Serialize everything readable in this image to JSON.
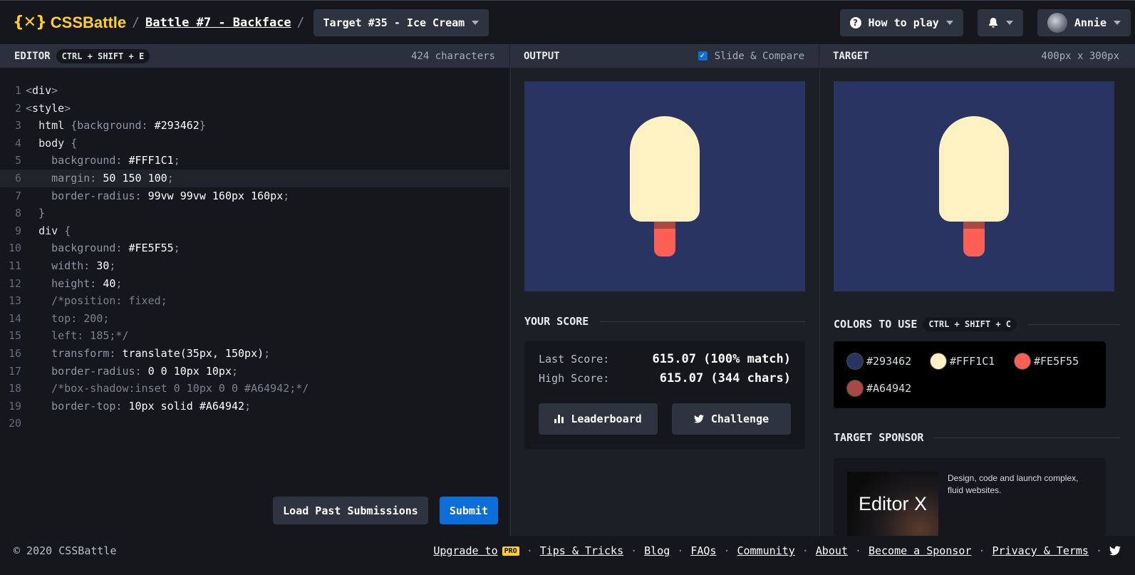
{
  "header": {
    "logo_mark": "{✕}",
    "logo_text": "CSSBattle",
    "battle": "Battle #7 - Backface",
    "target_select": "Target #35 - Ice Cream",
    "how_to_play": "How to play",
    "user": "Annie"
  },
  "editor": {
    "title": "EDITOR",
    "shortcut": "CTRL + SHIFT + E",
    "char_count": "424 characters",
    "load_past": "Load Past Submissions",
    "submit": "Submit",
    "lines": [
      "<div>",
      "<style>",
      "  html {background: #293462}",
      "  body {",
      "    background: #FFF1C1;",
      "    margin: 50 150 100;",
      "    border-radius: 99vw 99vw 160px 160px;",
      "  }",
      "  div {",
      "    background: #FE5F55;",
      "    width: 30;",
      "    height: 40;",
      "    /*position: fixed;",
      "    top: 200;",
      "    left: 185;*/",
      "    transform: translate(35px, 150px);",
      "    border-radius: 0 0 10px 10px;",
      "    /*box-shadow:inset 0 10px 0 0 #A64942;*/",
      "    border-top: 10px solid #A64942;",
      ""
    ]
  },
  "output": {
    "title": "OUTPUT",
    "slide_compare": "Slide & Compare"
  },
  "score": {
    "title": "YOUR SCORE",
    "last_label": "Last Score:",
    "last_value": "615.07 (100% match)",
    "high_label": "High Score:",
    "high_value": "615.07 (344 chars)",
    "leaderboard": "Leaderboard",
    "challenge": "Challenge"
  },
  "target": {
    "title": "TARGET",
    "size": "400px x 300px",
    "colors_title": "COLORS TO USE",
    "colors_shortcut": "CTRL + SHIFT + C",
    "colors": [
      "#293462",
      "#FFF1C1",
      "#FE5F55",
      "#A64942"
    ],
    "sponsor_title": "TARGET SPONSOR",
    "sponsor_logo": "Editor X",
    "sponsor_text": "Design, code and launch complex, fluid websites."
  },
  "footer": {
    "copyright": "© 2020 CSSBattle",
    "upgrade": "Upgrade to",
    "pro": "PRO",
    "links": [
      "Tips & Tricks",
      "Blog",
      "FAQs",
      "Community",
      "About",
      "Become a Sponsor",
      "Privacy & Terms"
    ]
  }
}
